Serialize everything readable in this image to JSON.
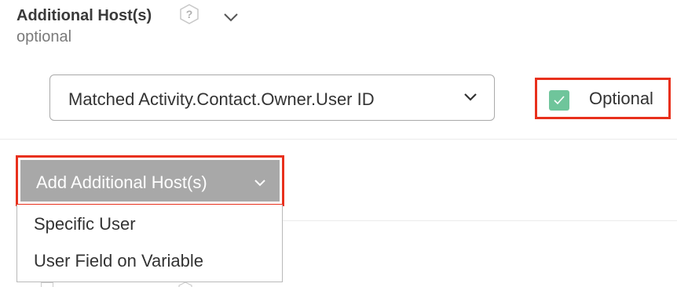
{
  "section": {
    "title": "Additional Host(s)",
    "subtitle": "optional",
    "help_icon_text": "?",
    "help_icon": "help-hexagon-icon",
    "collapse_icon": "chevron-down-icon"
  },
  "host_select": {
    "value": "Matched Activity.Contact.Owner.User ID",
    "icon": "chevron-down-icon"
  },
  "optional_toggle": {
    "label": "Optional",
    "checked": true,
    "check_color": "#6fc59b"
  },
  "add_button": {
    "label": "Add Additional Host(s)",
    "icon": "chevron-down-icon",
    "background": "#a8a8a8"
  },
  "dropdown": {
    "items": [
      {
        "label": "Specific User"
      },
      {
        "label": "User Field on Variable"
      }
    ]
  },
  "highlight_color": "#e8301c"
}
